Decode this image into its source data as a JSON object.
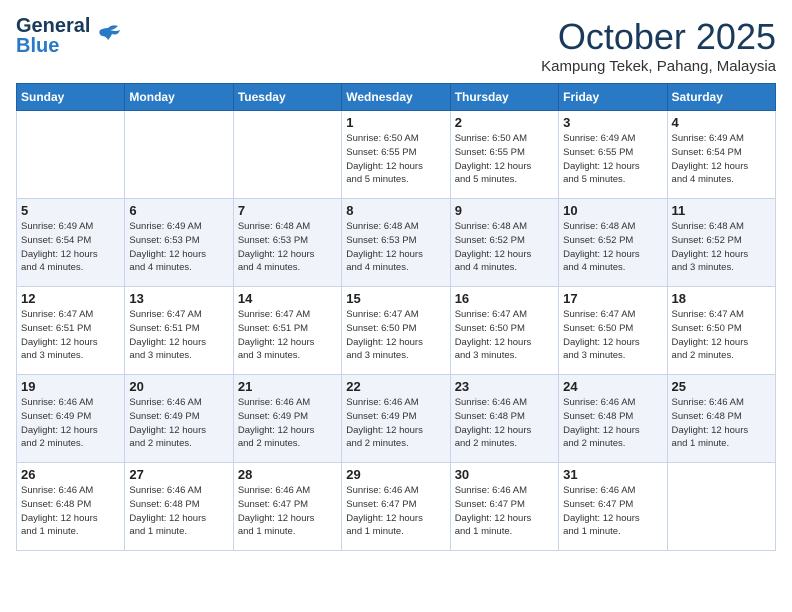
{
  "header": {
    "logo_line1": "General",
    "logo_line2": "Blue",
    "month": "October 2025",
    "location": "Kampung Tekek, Pahang, Malaysia"
  },
  "weekdays": [
    "Sunday",
    "Monday",
    "Tuesday",
    "Wednesday",
    "Thursday",
    "Friday",
    "Saturday"
  ],
  "weeks": [
    [
      {
        "day": "",
        "info": ""
      },
      {
        "day": "",
        "info": ""
      },
      {
        "day": "",
        "info": ""
      },
      {
        "day": "1",
        "info": "Sunrise: 6:50 AM\nSunset: 6:55 PM\nDaylight: 12 hours\nand 5 minutes."
      },
      {
        "day": "2",
        "info": "Sunrise: 6:50 AM\nSunset: 6:55 PM\nDaylight: 12 hours\nand 5 minutes."
      },
      {
        "day": "3",
        "info": "Sunrise: 6:49 AM\nSunset: 6:55 PM\nDaylight: 12 hours\nand 5 minutes."
      },
      {
        "day": "4",
        "info": "Sunrise: 6:49 AM\nSunset: 6:54 PM\nDaylight: 12 hours\nand 4 minutes."
      }
    ],
    [
      {
        "day": "5",
        "info": "Sunrise: 6:49 AM\nSunset: 6:54 PM\nDaylight: 12 hours\nand 4 minutes."
      },
      {
        "day": "6",
        "info": "Sunrise: 6:49 AM\nSunset: 6:53 PM\nDaylight: 12 hours\nand 4 minutes."
      },
      {
        "day": "7",
        "info": "Sunrise: 6:48 AM\nSunset: 6:53 PM\nDaylight: 12 hours\nand 4 minutes."
      },
      {
        "day": "8",
        "info": "Sunrise: 6:48 AM\nSunset: 6:53 PM\nDaylight: 12 hours\nand 4 minutes."
      },
      {
        "day": "9",
        "info": "Sunrise: 6:48 AM\nSunset: 6:52 PM\nDaylight: 12 hours\nand 4 minutes."
      },
      {
        "day": "10",
        "info": "Sunrise: 6:48 AM\nSunset: 6:52 PM\nDaylight: 12 hours\nand 4 minutes."
      },
      {
        "day": "11",
        "info": "Sunrise: 6:48 AM\nSunset: 6:52 PM\nDaylight: 12 hours\nand 3 minutes."
      }
    ],
    [
      {
        "day": "12",
        "info": "Sunrise: 6:47 AM\nSunset: 6:51 PM\nDaylight: 12 hours\nand 3 minutes."
      },
      {
        "day": "13",
        "info": "Sunrise: 6:47 AM\nSunset: 6:51 PM\nDaylight: 12 hours\nand 3 minutes."
      },
      {
        "day": "14",
        "info": "Sunrise: 6:47 AM\nSunset: 6:51 PM\nDaylight: 12 hours\nand 3 minutes."
      },
      {
        "day": "15",
        "info": "Sunrise: 6:47 AM\nSunset: 6:50 PM\nDaylight: 12 hours\nand 3 minutes."
      },
      {
        "day": "16",
        "info": "Sunrise: 6:47 AM\nSunset: 6:50 PM\nDaylight: 12 hours\nand 3 minutes."
      },
      {
        "day": "17",
        "info": "Sunrise: 6:47 AM\nSunset: 6:50 PM\nDaylight: 12 hours\nand 3 minutes."
      },
      {
        "day": "18",
        "info": "Sunrise: 6:47 AM\nSunset: 6:50 PM\nDaylight: 12 hours\nand 2 minutes."
      }
    ],
    [
      {
        "day": "19",
        "info": "Sunrise: 6:46 AM\nSunset: 6:49 PM\nDaylight: 12 hours\nand 2 minutes."
      },
      {
        "day": "20",
        "info": "Sunrise: 6:46 AM\nSunset: 6:49 PM\nDaylight: 12 hours\nand 2 minutes."
      },
      {
        "day": "21",
        "info": "Sunrise: 6:46 AM\nSunset: 6:49 PM\nDaylight: 12 hours\nand 2 minutes."
      },
      {
        "day": "22",
        "info": "Sunrise: 6:46 AM\nSunset: 6:49 PM\nDaylight: 12 hours\nand 2 minutes."
      },
      {
        "day": "23",
        "info": "Sunrise: 6:46 AM\nSunset: 6:48 PM\nDaylight: 12 hours\nand 2 minutes."
      },
      {
        "day": "24",
        "info": "Sunrise: 6:46 AM\nSunset: 6:48 PM\nDaylight: 12 hours\nand 2 minutes."
      },
      {
        "day": "25",
        "info": "Sunrise: 6:46 AM\nSunset: 6:48 PM\nDaylight: 12 hours\nand 1 minute."
      }
    ],
    [
      {
        "day": "26",
        "info": "Sunrise: 6:46 AM\nSunset: 6:48 PM\nDaylight: 12 hours\nand 1 minute."
      },
      {
        "day": "27",
        "info": "Sunrise: 6:46 AM\nSunset: 6:48 PM\nDaylight: 12 hours\nand 1 minute."
      },
      {
        "day": "28",
        "info": "Sunrise: 6:46 AM\nSunset: 6:47 PM\nDaylight: 12 hours\nand 1 minute."
      },
      {
        "day": "29",
        "info": "Sunrise: 6:46 AM\nSunset: 6:47 PM\nDaylight: 12 hours\nand 1 minute."
      },
      {
        "day": "30",
        "info": "Sunrise: 6:46 AM\nSunset: 6:47 PM\nDaylight: 12 hours\nand 1 minute."
      },
      {
        "day": "31",
        "info": "Sunrise: 6:46 AM\nSunset: 6:47 PM\nDaylight: 12 hours\nand 1 minute."
      },
      {
        "day": "",
        "info": ""
      }
    ]
  ]
}
